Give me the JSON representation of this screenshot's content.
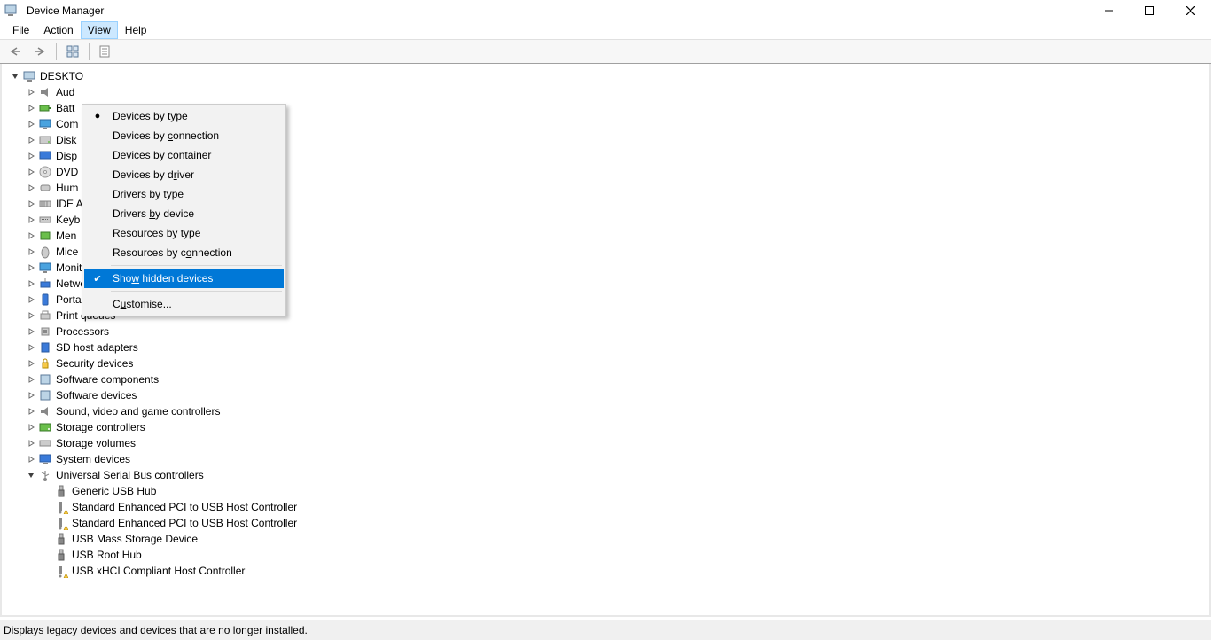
{
  "title": "Device Manager",
  "menubar": [
    {
      "label": "File",
      "mnemonic": "F"
    },
    {
      "label": "Action",
      "mnemonic": "A"
    },
    {
      "label": "View",
      "mnemonic": "V",
      "open": true
    },
    {
      "label": "Help",
      "mnemonic": "H"
    }
  ],
  "view_menu": {
    "items": [
      {
        "label": "Devices by type",
        "marker": "dot",
        "mnemonic_idx": 11
      },
      {
        "label": "Devices by connection",
        "mnemonic_idx": 11
      },
      {
        "label": "Devices by container",
        "mnemonic_idx": 12
      },
      {
        "label": "Devices by driver",
        "mnemonic_idx": 12
      },
      {
        "label": "Drivers by type",
        "mnemonic_idx": 11
      },
      {
        "label": "Drivers by device",
        "mnemonic_idx": 8
      },
      {
        "label": "Resources by type",
        "mnemonic_idx": 13
      },
      {
        "label": "Resources by connection",
        "mnemonic_idx": 14
      }
    ],
    "items2": [
      {
        "label": "Show hidden devices",
        "marker": "check",
        "highlight": true,
        "mnemonic_idx": 3
      },
      {
        "label": "Customise...",
        "mnemonic_idx": 1
      }
    ]
  },
  "tree": {
    "root": {
      "label": "DESKTO",
      "icon": "computer",
      "expander": "open"
    },
    "nodes": [
      {
        "label": "Aud",
        "icon": "audio",
        "expander": "closed"
      },
      {
        "label": "Batt",
        "icon": "battery",
        "expander": "closed"
      },
      {
        "label": "Com",
        "icon": "monitor",
        "expander": "closed"
      },
      {
        "label": "Disk",
        "icon": "disk",
        "expander": "closed"
      },
      {
        "label": "Disp",
        "icon": "display",
        "expander": "closed"
      },
      {
        "label": "DVD",
        "icon": "dvd",
        "expander": "closed"
      },
      {
        "label": "Hum",
        "icon": "hid",
        "expander": "closed"
      },
      {
        "label": "IDE A",
        "icon": "ide",
        "expander": "closed"
      },
      {
        "label": "Keyb",
        "icon": "keyboard",
        "expander": "closed"
      },
      {
        "label": "Men",
        "icon": "memory",
        "expander": "closed"
      },
      {
        "label": "Mice",
        "icon": "mouse",
        "expander": "closed"
      },
      {
        "label": "Monitors",
        "icon": "monitor",
        "expander": "closed"
      },
      {
        "label": "Network adapters",
        "icon": "network",
        "expander": "closed"
      },
      {
        "label": "Portable Devices",
        "icon": "portable",
        "expander": "closed"
      },
      {
        "label": "Print queues",
        "icon": "printer",
        "expander": "closed"
      },
      {
        "label": "Processors",
        "icon": "cpu",
        "expander": "closed"
      },
      {
        "label": "SD host adapters",
        "icon": "sd",
        "expander": "closed"
      },
      {
        "label": "Security devices",
        "icon": "security",
        "expander": "closed"
      },
      {
        "label": "Software components",
        "icon": "software",
        "expander": "closed"
      },
      {
        "label": "Software devices",
        "icon": "software",
        "expander": "closed"
      },
      {
        "label": "Sound, video and game controllers",
        "icon": "audio",
        "expander": "closed"
      },
      {
        "label": "Storage controllers",
        "icon": "storage",
        "expander": "closed"
      },
      {
        "label": "Storage volumes",
        "icon": "volume",
        "expander": "closed"
      },
      {
        "label": "System devices",
        "icon": "system",
        "expander": "closed"
      },
      {
        "label": "Universal Serial Bus controllers",
        "icon": "usb",
        "expander": "open"
      }
    ],
    "usb_children": [
      {
        "label": "Generic USB Hub",
        "icon": "usb-plug"
      },
      {
        "label": "Standard Enhanced PCI to USB Host Controller",
        "icon": "usb-warn"
      },
      {
        "label": "Standard Enhanced PCI to USB Host Controller",
        "icon": "usb-warn"
      },
      {
        "label": "USB Mass Storage Device",
        "icon": "usb-plug"
      },
      {
        "label": "USB Root Hub",
        "icon": "usb-plug"
      },
      {
        "label": "USB xHCI Compliant Host Controller",
        "icon": "usb-warn"
      }
    ]
  },
  "statusbar": "Displays legacy devices and devices that are no longer installed."
}
